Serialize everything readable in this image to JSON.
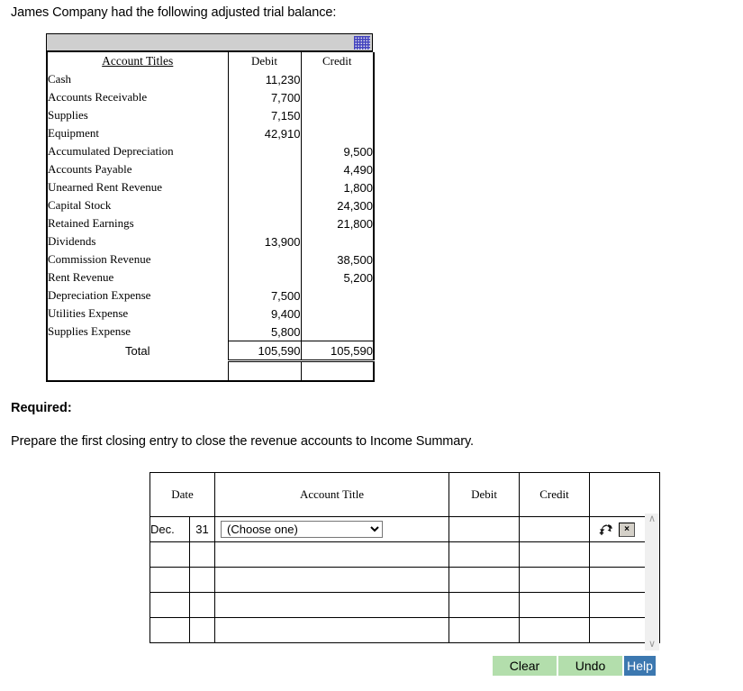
{
  "intro": {
    "text": "James Company had the following adjusted trial balance:"
  },
  "trial_balance": {
    "columns": [
      "Account Titles",
      "Debit",
      "Credit"
    ],
    "rows": [
      {
        "account": "Cash",
        "debit": "11,230",
        "credit": ""
      },
      {
        "account": "Accounts Receivable",
        "debit": "7,700",
        "credit": ""
      },
      {
        "account": "Supplies",
        "debit": "7,150",
        "credit": ""
      },
      {
        "account": "Equipment",
        "debit": "42,910",
        "credit": ""
      },
      {
        "account": "Accumulated Depreciation",
        "debit": "",
        "credit": "9,500"
      },
      {
        "account": "Accounts Payable",
        "debit": "",
        "credit": "4,490"
      },
      {
        "account": "Unearned Rent Revenue",
        "debit": "",
        "credit": "1,800"
      },
      {
        "account": "Capital Stock",
        "debit": "",
        "credit": "24,300"
      },
      {
        "account": "Retained Earnings",
        "debit": "",
        "credit": "21,800"
      },
      {
        "account": "Dividends",
        "debit": "13,900",
        "credit": ""
      },
      {
        "account": "Commission Revenue",
        "debit": "",
        "credit": "38,500"
      },
      {
        "account": "Rent Revenue",
        "debit": "",
        "credit": "5,200"
      },
      {
        "account": "Depreciation Expense",
        "debit": "7,500",
        "credit": ""
      },
      {
        "account": "Utilities Expense",
        "debit": "9,400",
        "credit": ""
      },
      {
        "account": "Supplies Expense",
        "debit": "5,800",
        "credit": ""
      }
    ],
    "total": {
      "account": "Total",
      "debit": "105,590",
      "credit": "105,590"
    }
  },
  "required": {
    "label": "Required:",
    "text": "Prepare the first closing entry to close the revenue accounts to Income Summary."
  },
  "journal": {
    "columns": [
      "Date",
      "Account Title",
      "Debit",
      "Credit",
      ""
    ],
    "rows": [
      {
        "month": "Dec.",
        "day": "31",
        "account_select": "(Choose one)",
        "debit": "",
        "credit": "",
        "has_actions": true
      },
      {
        "month": "",
        "day": "",
        "account_select": "",
        "debit": "",
        "credit": "",
        "has_actions": false
      },
      {
        "month": "",
        "day": "",
        "account_select": "",
        "debit": "",
        "credit": "",
        "has_actions": false
      },
      {
        "month": "",
        "day": "",
        "account_select": "",
        "debit": "",
        "credit": "",
        "has_actions": false
      },
      {
        "month": "",
        "day": "",
        "account_select": "",
        "debit": "",
        "credit": "",
        "has_actions": false
      }
    ],
    "delete_button_label": "×",
    "scrollbar": {
      "up": "∧",
      "down": "∨"
    }
  },
  "buttons": {
    "clear": "Clear",
    "undo": "Undo",
    "help": "Help"
  },
  "colors": {
    "button_green": "#b3deac",
    "button_blue": "#3c78b0",
    "titlebar_gray": "#cfcfcf",
    "grip_blue": "#2b2bbd"
  }
}
